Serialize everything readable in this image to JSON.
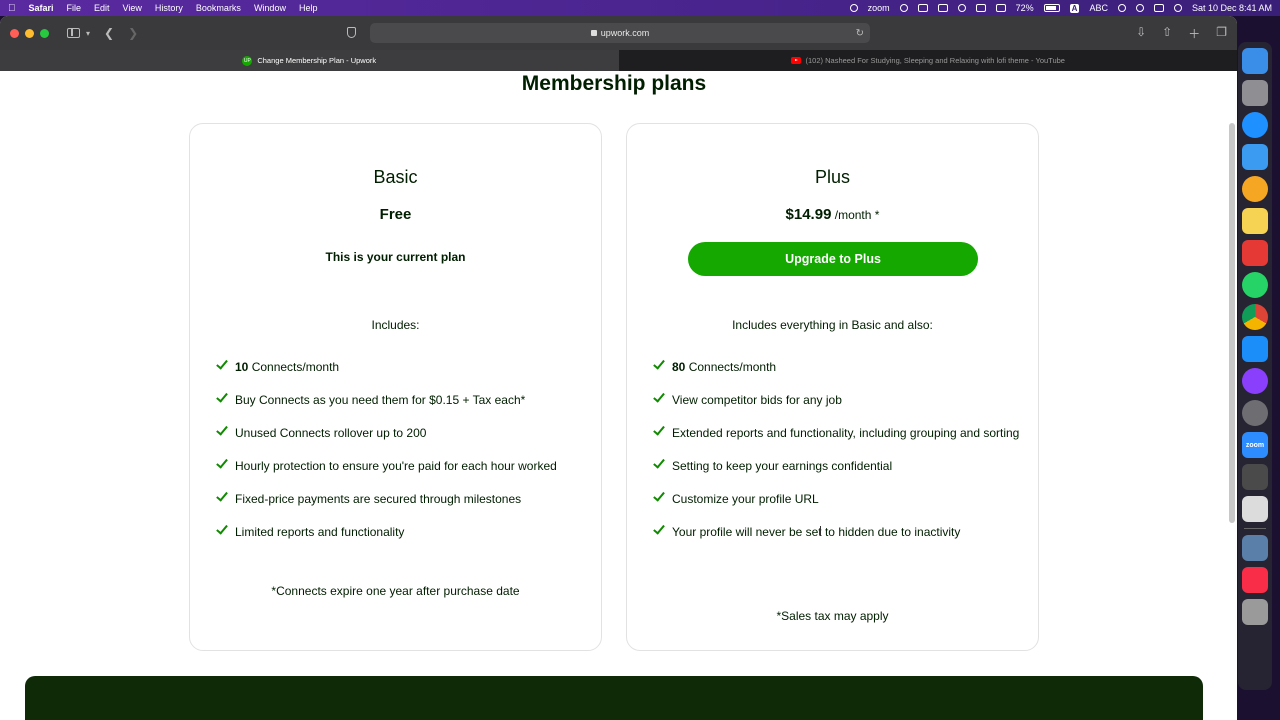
{
  "menubar": {
    "app_name": "Safari",
    "items": [
      "File",
      "Edit",
      "View",
      "History",
      "Bookmarks",
      "Window",
      "Help"
    ],
    "zoom_label": "zoom",
    "battery": "72%",
    "input_source": "ABC",
    "input_badge": "A",
    "datetime": "Sat 10 Dec 8:41 AM"
  },
  "browser": {
    "url": "upwork.com",
    "tabs": [
      {
        "title": "Change Membership Plan - Upwork",
        "active": true
      },
      {
        "title": "(102) Nasheed For Studying, Sleeping and Relaxing with lofi theme - YouTube",
        "active": false
      }
    ],
    "favicon_upwork": "UP"
  },
  "page": {
    "title": "Membership plans"
  },
  "plans": {
    "basic": {
      "name": "Basic",
      "price": "Free",
      "status": "This is your current plan",
      "includes": "Includes:",
      "features": [
        {
          "bold": "10",
          "text": " Connects/month"
        },
        {
          "bold": "",
          "text": "Buy Connects as you need them for $0.15 + Tax each*"
        },
        {
          "bold": "",
          "text": "Unused Connects rollover up to 200"
        },
        {
          "bold": "",
          "text": "Hourly protection to ensure you're paid for each hour worked"
        },
        {
          "bold": "",
          "text": "Fixed-price payments are secured through milestones"
        },
        {
          "bold": "",
          "text": "Limited reports and functionality"
        }
      ],
      "footnote": "*Connects expire one year after purchase date"
    },
    "plus": {
      "name": "Plus",
      "price": "$14.99",
      "price_suffix": " /month *",
      "cta": "Upgrade to Plus",
      "includes": "Includes everything in Basic and also:",
      "features": [
        {
          "bold": "80",
          "text": " Connects/month"
        },
        {
          "bold": "",
          "text": "View competitor bids for any job"
        },
        {
          "bold": "",
          "text": "Extended reports and functionality, including grouping and sorting"
        },
        {
          "bold": "",
          "text": "Setting to keep your earnings confidential"
        },
        {
          "bold": "",
          "text": "Customize your profile URL"
        },
        {
          "bold": "",
          "text": "Your profile will never be set to hidden due to inactivity"
        }
      ],
      "footnote": "*Sales tax may apply"
    }
  },
  "colors": {
    "brand_green": "#14a800",
    "check_green": "#108a00",
    "text_dark": "#001e00",
    "band_dark": "#0e2a06"
  },
  "dock": {
    "zoom_label": "zoom",
    "apps": [
      {
        "name": "finder-icon",
        "color": "#3b8ee8"
      },
      {
        "name": "launchpad-icon",
        "color": "#8e8e93"
      },
      {
        "name": "safari-icon",
        "color": "#1e90ff"
      },
      {
        "name": "mail-icon",
        "color": "#3a9bf0"
      },
      {
        "name": "photos-icon",
        "color": "#f5a623"
      },
      {
        "name": "notes-icon",
        "color": "#f7d354"
      },
      {
        "name": "anydesk-icon",
        "color": "#e53935"
      },
      {
        "name": "whatsapp-icon",
        "color": "#25d366"
      },
      {
        "name": "chrome-icon",
        "color": "#f4b400"
      },
      {
        "name": "app-store-icon",
        "color": "#1c8ef9"
      },
      {
        "name": "messenger-icon",
        "color": "#8a3ffc"
      },
      {
        "name": "system-preferences-icon",
        "color": "#6d6d72"
      },
      {
        "name": "zoom-icon",
        "color": "#2d8cff"
      },
      {
        "name": "calculator-icon",
        "color": "#4a4a4a"
      },
      {
        "name": "screenshot-icon",
        "color": "#dcdcdc"
      },
      {
        "name": "preview-icon",
        "color": "#5a7fa8"
      },
      {
        "name": "music-icon",
        "color": "#fa2d48"
      },
      {
        "name": "trash-icon",
        "color": "#9a9a9a"
      }
    ]
  }
}
